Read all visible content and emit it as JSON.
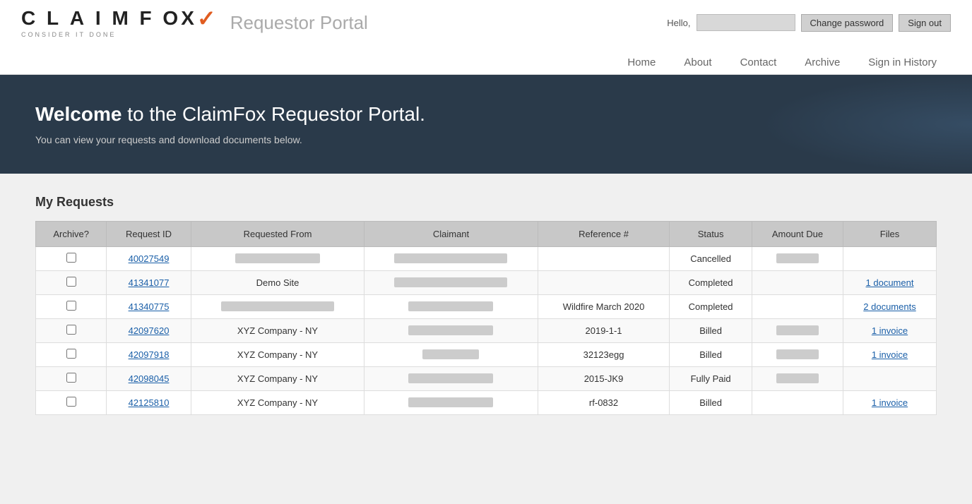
{
  "header": {
    "logo_company": "CLAIMFOX",
    "logo_tagline": "CONSIDER IT DONE",
    "portal_title": "Requestor Portal",
    "hello_text": "Hello,",
    "change_password_label": "Change password",
    "sign_out_label": "Sign out"
  },
  "nav": {
    "items": [
      {
        "label": "Home",
        "id": "home"
      },
      {
        "label": "About",
        "id": "about"
      },
      {
        "label": "Contact",
        "id": "contact"
      },
      {
        "label": "Archive",
        "id": "archive"
      },
      {
        "label": "Sign in History",
        "id": "sign-in-history"
      }
    ]
  },
  "hero": {
    "heading_bold": "Welcome",
    "heading_rest": " to the ClaimFox Requestor Portal.",
    "subtext": "You can view your requests and download documents below."
  },
  "my_requests": {
    "section_title": "My Requests",
    "columns": [
      "Archive?",
      "Request ID",
      "Requested From",
      "Claimant",
      "Reference #",
      "Status",
      "Amount Due",
      "Files"
    ],
    "rows": [
      {
        "archive": false,
        "request_id": "40027549",
        "requested_from": "",
        "claimant": "",
        "reference": "",
        "status": "Cancelled",
        "amount_due": "",
        "files": ""
      },
      {
        "archive": false,
        "request_id": "41341077",
        "requested_from": "Demo Site",
        "claimant": "",
        "reference": "",
        "status": "Completed",
        "amount_due": "",
        "files": "1 document"
      },
      {
        "archive": false,
        "request_id": "41340775",
        "requested_from": "",
        "claimant": "",
        "reference": "Wildfire March 2020",
        "status": "Completed",
        "amount_due": "",
        "files": "2 documents"
      },
      {
        "archive": false,
        "request_id": "42097620",
        "requested_from": "XYZ Company - NY",
        "claimant": "",
        "reference": "2019-1-1",
        "status": "Billed",
        "amount_due": "",
        "files": "1 invoice"
      },
      {
        "archive": false,
        "request_id": "42097918",
        "requested_from": "XYZ Company - NY",
        "claimant": "",
        "reference": "32123egg",
        "status": "Billed",
        "amount_due": "",
        "files": "1 invoice"
      },
      {
        "archive": false,
        "request_id": "42098045",
        "requested_from": "XYZ Company - NY",
        "claimant": "",
        "reference": "2015-JK9",
        "status": "Fully Paid",
        "amount_due": "",
        "files": ""
      },
      {
        "archive": false,
        "request_id": "42125810",
        "requested_from": "XYZ Company - NY",
        "claimant": "",
        "reference": "rf-0832",
        "status": "Billed",
        "amount_due": "",
        "files": "1 invoice"
      }
    ]
  }
}
